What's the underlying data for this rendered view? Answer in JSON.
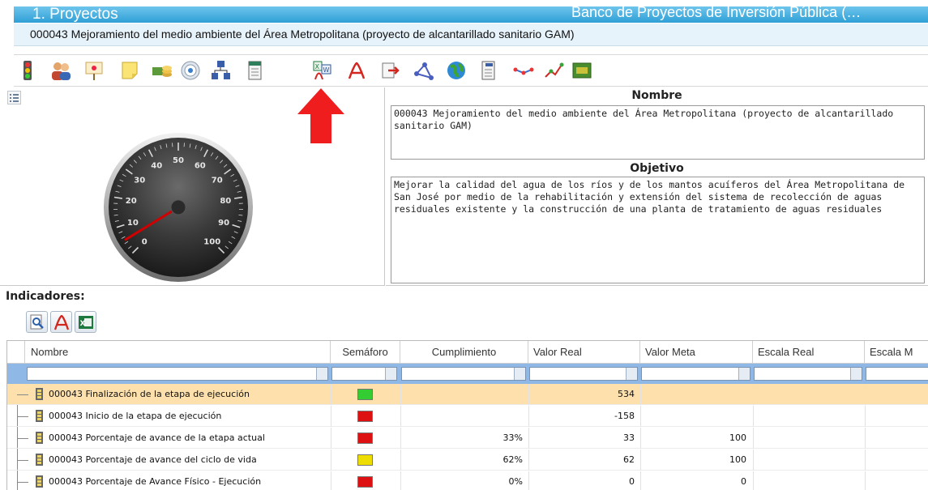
{
  "header": {
    "title": "1. Proyectos",
    "app_title": "Banco de Proyectos de Inversión Pública (…",
    "project_line": "000043 Mejoramiento del medio ambiente del Área Metropolitana (proyecto de alcantarillado sanitario GAM)"
  },
  "toolbar": {
    "icons": [
      "traffic-light-icon",
      "users-icon",
      "presentation-icon",
      "sticky-note-icon",
      "coins-icon",
      "target-icon",
      "hierarchy-icon",
      "document-icon",
      "excel-word-pdf-icon",
      "pdf-icon",
      "export-icon",
      "share-graph-icon",
      "globe-icon",
      "log-document-icon",
      "graph-icon",
      "chart-icon",
      "money-icon"
    ]
  },
  "details": {
    "nombre_label": "Nombre",
    "nombre_value": "000043 Mejoramiento del medio ambiente del Área Metropolitana (proyecto de alcantarillado sanitario GAM)",
    "objetivo_label": "Objetivo",
    "objetivo_value": "Mejorar la calidad del agua de los ríos y de los mantos acuíferos del Área Metropolitana de San José por medio de la rehabilitación y extensión del sistema de recolección de aguas residuales existente y la construcción de una planta de tratamiento de aguas residuales"
  },
  "gauge": {
    "ticks": [
      "0",
      "10",
      "20",
      "30",
      "40",
      "50",
      "60",
      "70",
      "80",
      "90",
      "100"
    ],
    "value": 0.05
  },
  "indicators": {
    "title": "Indicadores:",
    "buttons": [
      "preview-icon",
      "pdf-icon",
      "excel-icon"
    ],
    "columns": [
      "Nombre",
      "Semáforo",
      "Cumplimiento",
      "Valor Real",
      "Valor Meta",
      "Escala Real",
      "Escala M"
    ],
    "rows": [
      {
        "nombre": "000043 Finalización de la etapa de ejecución",
        "semaforo": "#33cc33",
        "cumplimiento": "",
        "valor_real": "534",
        "valor_meta": "",
        "selected": true
      },
      {
        "nombre": "000043 Inicio de la etapa de ejecución",
        "semaforo": "#dd1111",
        "cumplimiento": "",
        "valor_real": "-158",
        "valor_meta": "",
        "selected": false
      },
      {
        "nombre": "000043 Porcentaje de avance de la etapa actual",
        "semaforo": "#dd1111",
        "cumplimiento": "33%",
        "valor_real": "33",
        "valor_meta": "100",
        "selected": false
      },
      {
        "nombre": "000043 Porcentaje de avance del ciclo de vida",
        "semaforo": "#eedd00",
        "cumplimiento": "62%",
        "valor_real": "62",
        "valor_meta": "100",
        "selected": false
      },
      {
        "nombre": "000043 Porcentaje de Avance Físico - Ejecución",
        "semaforo": "#dd1111",
        "cumplimiento": "0%",
        "valor_real": "0",
        "valor_meta": "0",
        "selected": false
      }
    ]
  }
}
